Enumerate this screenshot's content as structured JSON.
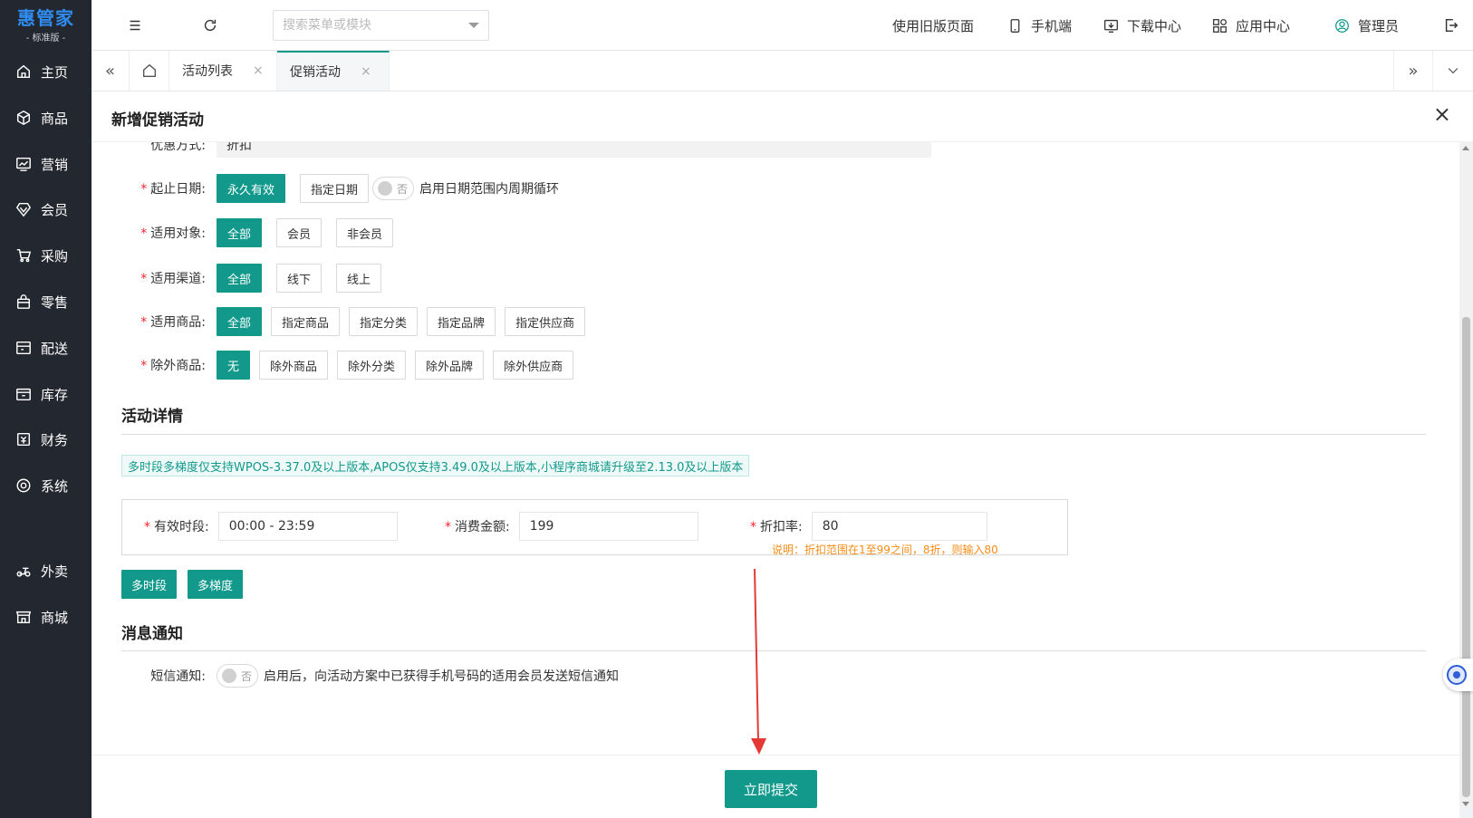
{
  "app": {
    "logo_title": "惠管家",
    "logo_sub": "- 标准版 -"
  },
  "sidebar": {
    "items": [
      {
        "label": "主页",
        "icon": "home-icon"
      },
      {
        "label": "商品",
        "icon": "box-icon"
      },
      {
        "label": "营销",
        "icon": "chart-icon"
      },
      {
        "label": "会员",
        "icon": "diamond-icon"
      },
      {
        "label": "采购",
        "icon": "cart-icon"
      },
      {
        "label": "零售",
        "icon": "bag-icon"
      },
      {
        "label": "配送",
        "icon": "delivery-icon"
      },
      {
        "label": "库存",
        "icon": "inventory-icon"
      },
      {
        "label": "财务",
        "icon": "finance-icon"
      },
      {
        "label": "系统",
        "icon": "settings-icon"
      },
      {
        "label": "外卖",
        "icon": "scooter-icon"
      },
      {
        "label": "商城",
        "icon": "store-icon"
      }
    ]
  },
  "header": {
    "search_placeholder": "搜索菜单或模块",
    "old_version": "使用旧版页面",
    "mobile": "手机端",
    "download": "下载中心",
    "apps": "应用中心",
    "user": "管理员"
  },
  "tabs": [
    {
      "label": "活动列表",
      "active": false
    },
    {
      "label": "促销活动",
      "active": true
    }
  ],
  "dialog": {
    "title": "新增促销活动",
    "close": "×"
  },
  "form": {
    "discount_type": {
      "label": "优惠方式:",
      "value": "折扣"
    },
    "date": {
      "label": "起止日期:",
      "options": [
        "永久有效",
        "指定日期"
      ],
      "selected": "永久有效",
      "switch_text": "否",
      "switch_hint": "启用日期范围内周期循环"
    },
    "target": {
      "label": "适用对象:",
      "options": [
        "全部",
        "会员",
        "非会员"
      ],
      "selected": "全部"
    },
    "channel": {
      "label": "适用渠道:",
      "options": [
        "全部",
        "线下",
        "线上"
      ],
      "selected": "全部"
    },
    "goods": {
      "label": "适用商品:",
      "options": [
        "全部",
        "指定商品",
        "指定分类",
        "指定品牌",
        "指定供应商"
      ],
      "selected": "全部"
    },
    "exclude": {
      "label": "除外商品:",
      "options": [
        "无",
        "除外商品",
        "除外分类",
        "除外品牌",
        "除外供应商"
      ],
      "selected": "无"
    }
  },
  "details": {
    "title": "活动详情",
    "notice": "多时段多梯度仅支持WPOS-3.37.0及以上版本,APOS仅支持3.49.0及以上版本,小程序商城请升级至2.13.0及以上版本",
    "period_label": "有效时段:",
    "period_value": "00:00 - 23:59",
    "amount_label": "消费金额:",
    "amount_value": "199",
    "rate_label": "折扣率:",
    "rate_value": "80",
    "rate_note": "说明：折扣范围在1至99之间，8折，则输入80",
    "multi_period": "多时段",
    "multi_tier": "多梯度"
  },
  "notify": {
    "title": "消息通知",
    "sms_label": "短信通知:",
    "switch_text": "否",
    "hint": "启用后，向活动方案中已获得手机号码的适用会员发送短信通知"
  },
  "footer": {
    "submit": "立即提交"
  },
  "colors": {
    "primary": "#12998c",
    "sidebar_bg": "#23272f",
    "required": "#f5222d",
    "note": "#fa8c16",
    "arrow": "#e53935"
  }
}
